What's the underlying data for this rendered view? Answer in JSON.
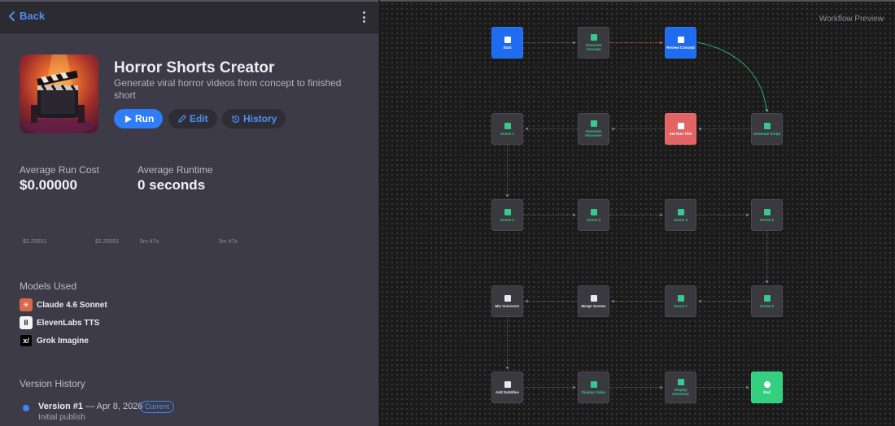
{
  "topbar": {
    "back_label": "Back"
  },
  "header": {
    "title": "Horror Shorts Creator",
    "description": "Generate viral horror videos from concept to finished short"
  },
  "actions": {
    "run": "Run",
    "edit": "Edit",
    "history": "History"
  },
  "stats": {
    "avg_cost_label": "Average Run Cost",
    "avg_cost_value": "$0.00000",
    "avg_runtime_label": "Average Runtime",
    "avg_runtime_value": "0 seconds",
    "ticks": [
      "$2.25051",
      "$2.25051",
      "5m 47s",
      "5m 47s"
    ]
  },
  "models": {
    "title": "Models Used",
    "items": [
      {
        "name": "Claude 4.6 Sonnet",
        "icon": "claude-icon"
      },
      {
        "name": "ElevenLabs TTS",
        "icon": "elevenlabs-icon"
      },
      {
        "name": "Grok Imagine",
        "icon": "grok-icon"
      }
    ]
  },
  "versions": {
    "title": "Version History",
    "items": [
      {
        "name": "Version #1",
        "date": "— Apr 8, 2026",
        "badge": "Current",
        "note": "Initial publish"
      }
    ]
  },
  "workflow": {
    "label": "Workflow Preview",
    "colors": {
      "blue": "#1f6cf0",
      "red": "#e36464",
      "green": "#35d07f",
      "teal": "#36c98a"
    },
    "nodes": [
      {
        "id": "start",
        "label": "Start"
      },
      {
        "id": "generate-concept",
        "label": "Generate Concept"
      },
      {
        "id": "review-concept",
        "label": "Review Concept"
      },
      {
        "id": "generate-script",
        "label": "Generate Script"
      },
      {
        "id": "set-run-title",
        "label": "Set Run Title"
      },
      {
        "id": "generate-voiceover",
        "label": "Generate Voiceover"
      },
      {
        "id": "scene-1",
        "label": "Scene 1"
      },
      {
        "id": "scene-2",
        "label": "Scene 2"
      },
      {
        "id": "scene-3",
        "label": "Scene 3"
      },
      {
        "id": "scene-4",
        "label": "Scene 4"
      },
      {
        "id": "scene-5",
        "label": "Scene 5"
      },
      {
        "id": "scene-6",
        "label": "Scene 6"
      },
      {
        "id": "scene-7",
        "label": "Scene 7"
      },
      {
        "id": "merge-scenes",
        "label": "Merge Scenes"
      },
      {
        "id": "mix-voiceover",
        "label": "Mix Voiceover"
      },
      {
        "id": "add-subtitles",
        "label": "Add Subtitles"
      },
      {
        "id": "display-video",
        "label": "Display Video"
      },
      {
        "id": "display-summary",
        "label": "Display Summary"
      },
      {
        "id": "end",
        "label": "End"
      }
    ]
  }
}
